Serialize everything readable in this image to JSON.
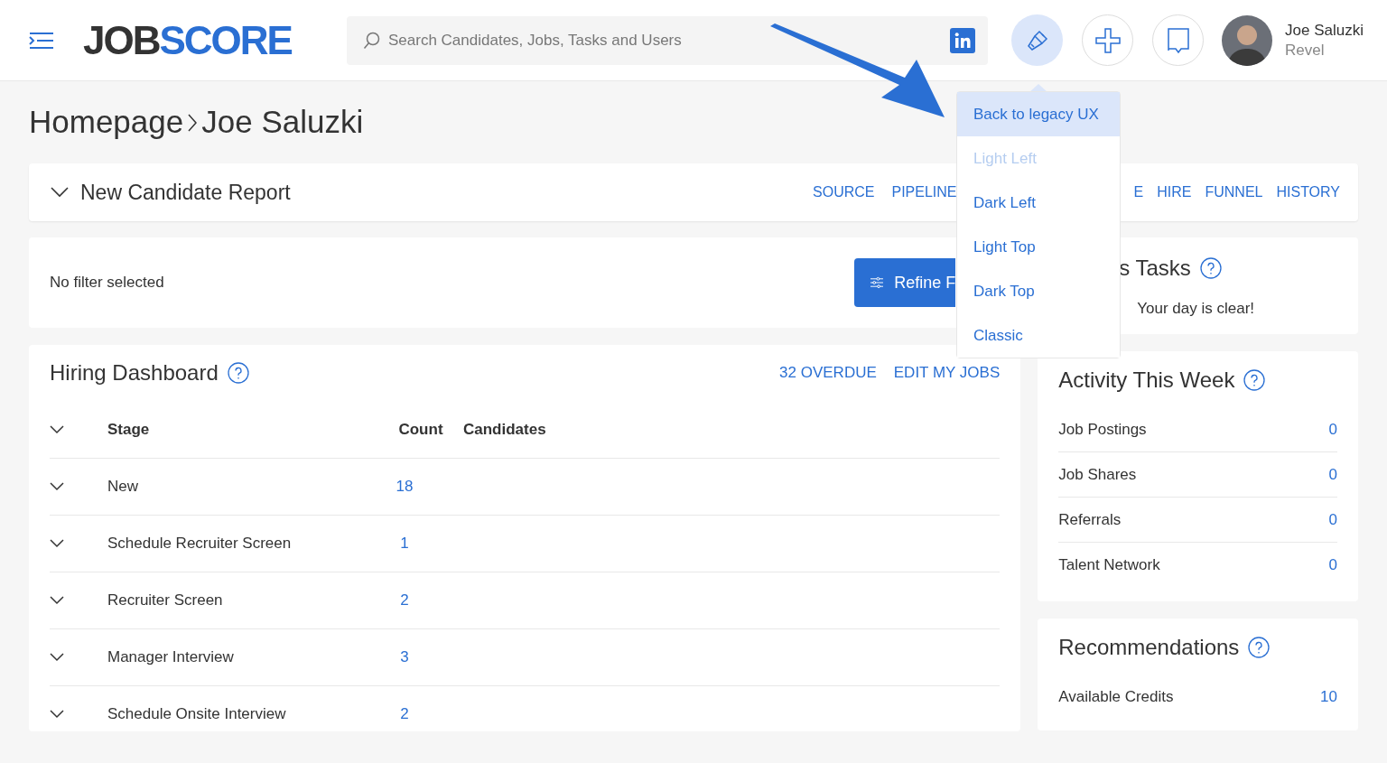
{
  "header": {
    "logo": [
      "JOB",
      "SCORE"
    ],
    "search": {
      "placeholder": "Search Candidates, Jobs, Tasks and Users"
    },
    "user": {
      "name": "Joe Saluzki",
      "company": "Revel"
    }
  },
  "breadcrumb": [
    "Homepage",
    "Joe Saluzki"
  ],
  "report": {
    "title": "New Candidate Report",
    "tabs_left": [
      "SOURCE",
      "PIPELINE"
    ],
    "tabs_right": [
      "E",
      "HIRE",
      "FUNNEL",
      "HISTORY"
    ]
  },
  "filter": {
    "text": "No filter selected",
    "button": "Refine F"
  },
  "dashboard": {
    "title": "Hiring Dashboard",
    "actions": [
      "32 OVERDUE",
      "EDIT MY JOBS"
    ],
    "columns": [
      "Stage",
      "Count",
      "Candidates"
    ],
    "rows": [
      {
        "stage": "New",
        "count": "18"
      },
      {
        "stage": "Schedule Recruiter Screen",
        "count": "1"
      },
      {
        "stage": "Recruiter Screen",
        "count": "2"
      },
      {
        "stage": "Manager Interview",
        "count": "3"
      },
      {
        "stage": "Schedule Onsite Interview",
        "count": "2"
      }
    ]
  },
  "tasks": {
    "title": "s Tasks",
    "message": "Your day is clear!"
  },
  "activity": {
    "title": "Activity This Week",
    "rows": [
      {
        "label": "Job Postings",
        "value": "0"
      },
      {
        "label": "Job Shares",
        "value": "0"
      },
      {
        "label": "Referrals",
        "value": "0"
      },
      {
        "label": "Talent Network",
        "value": "0"
      }
    ]
  },
  "recommendations": {
    "title": "Recommendations",
    "rows": [
      {
        "label": "Available Credits",
        "value": "10"
      }
    ]
  },
  "menu": {
    "items": [
      {
        "label": "Back to legacy UX",
        "selected": true,
        "disabled": false
      },
      {
        "label": "Light Left",
        "selected": false,
        "disabled": true
      },
      {
        "label": "Dark Left",
        "selected": false,
        "disabled": false
      },
      {
        "label": "Light Top",
        "selected": false,
        "disabled": false
      },
      {
        "label": "Dark Top",
        "selected": false,
        "disabled": false
      },
      {
        "label": "Classic",
        "selected": false,
        "disabled": false
      }
    ]
  }
}
